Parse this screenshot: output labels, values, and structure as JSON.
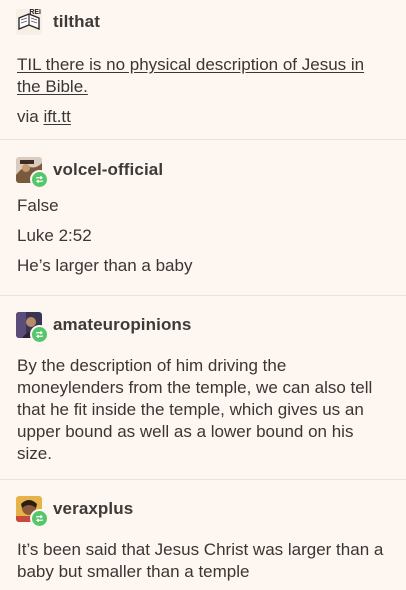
{
  "colors": {
    "background": "#fdf6f1",
    "text": "#3a3634",
    "reblog_badge": "#55c66b",
    "divider": "#ece2da"
  },
  "posts": [
    {
      "username": "tilthat",
      "avatar_icon": "book-icon",
      "avatar_text": "REI",
      "title": "TIL there is no physical description of Jesus in the Bible.",
      "via_label": "via",
      "via_link": "ift.tt"
    },
    {
      "username": "volcel-official",
      "avatar_icon": "avatar-photo",
      "lines": [
        "False",
        "Luke 2:52",
        "He’s larger than a baby"
      ]
    },
    {
      "username": "amateuropinions",
      "avatar_icon": "avatar-photo",
      "text": "By the description of him driving the moneylenders from the temple, we can also tell that he fit inside the temple, which gives us an upper bound as well as a lower bound on his size."
    },
    {
      "username": "veraxplus",
      "avatar_icon": "avatar-photo",
      "text": "It’s been said that Jesus Christ was larger than a baby but smaller than a temple"
    }
  ]
}
